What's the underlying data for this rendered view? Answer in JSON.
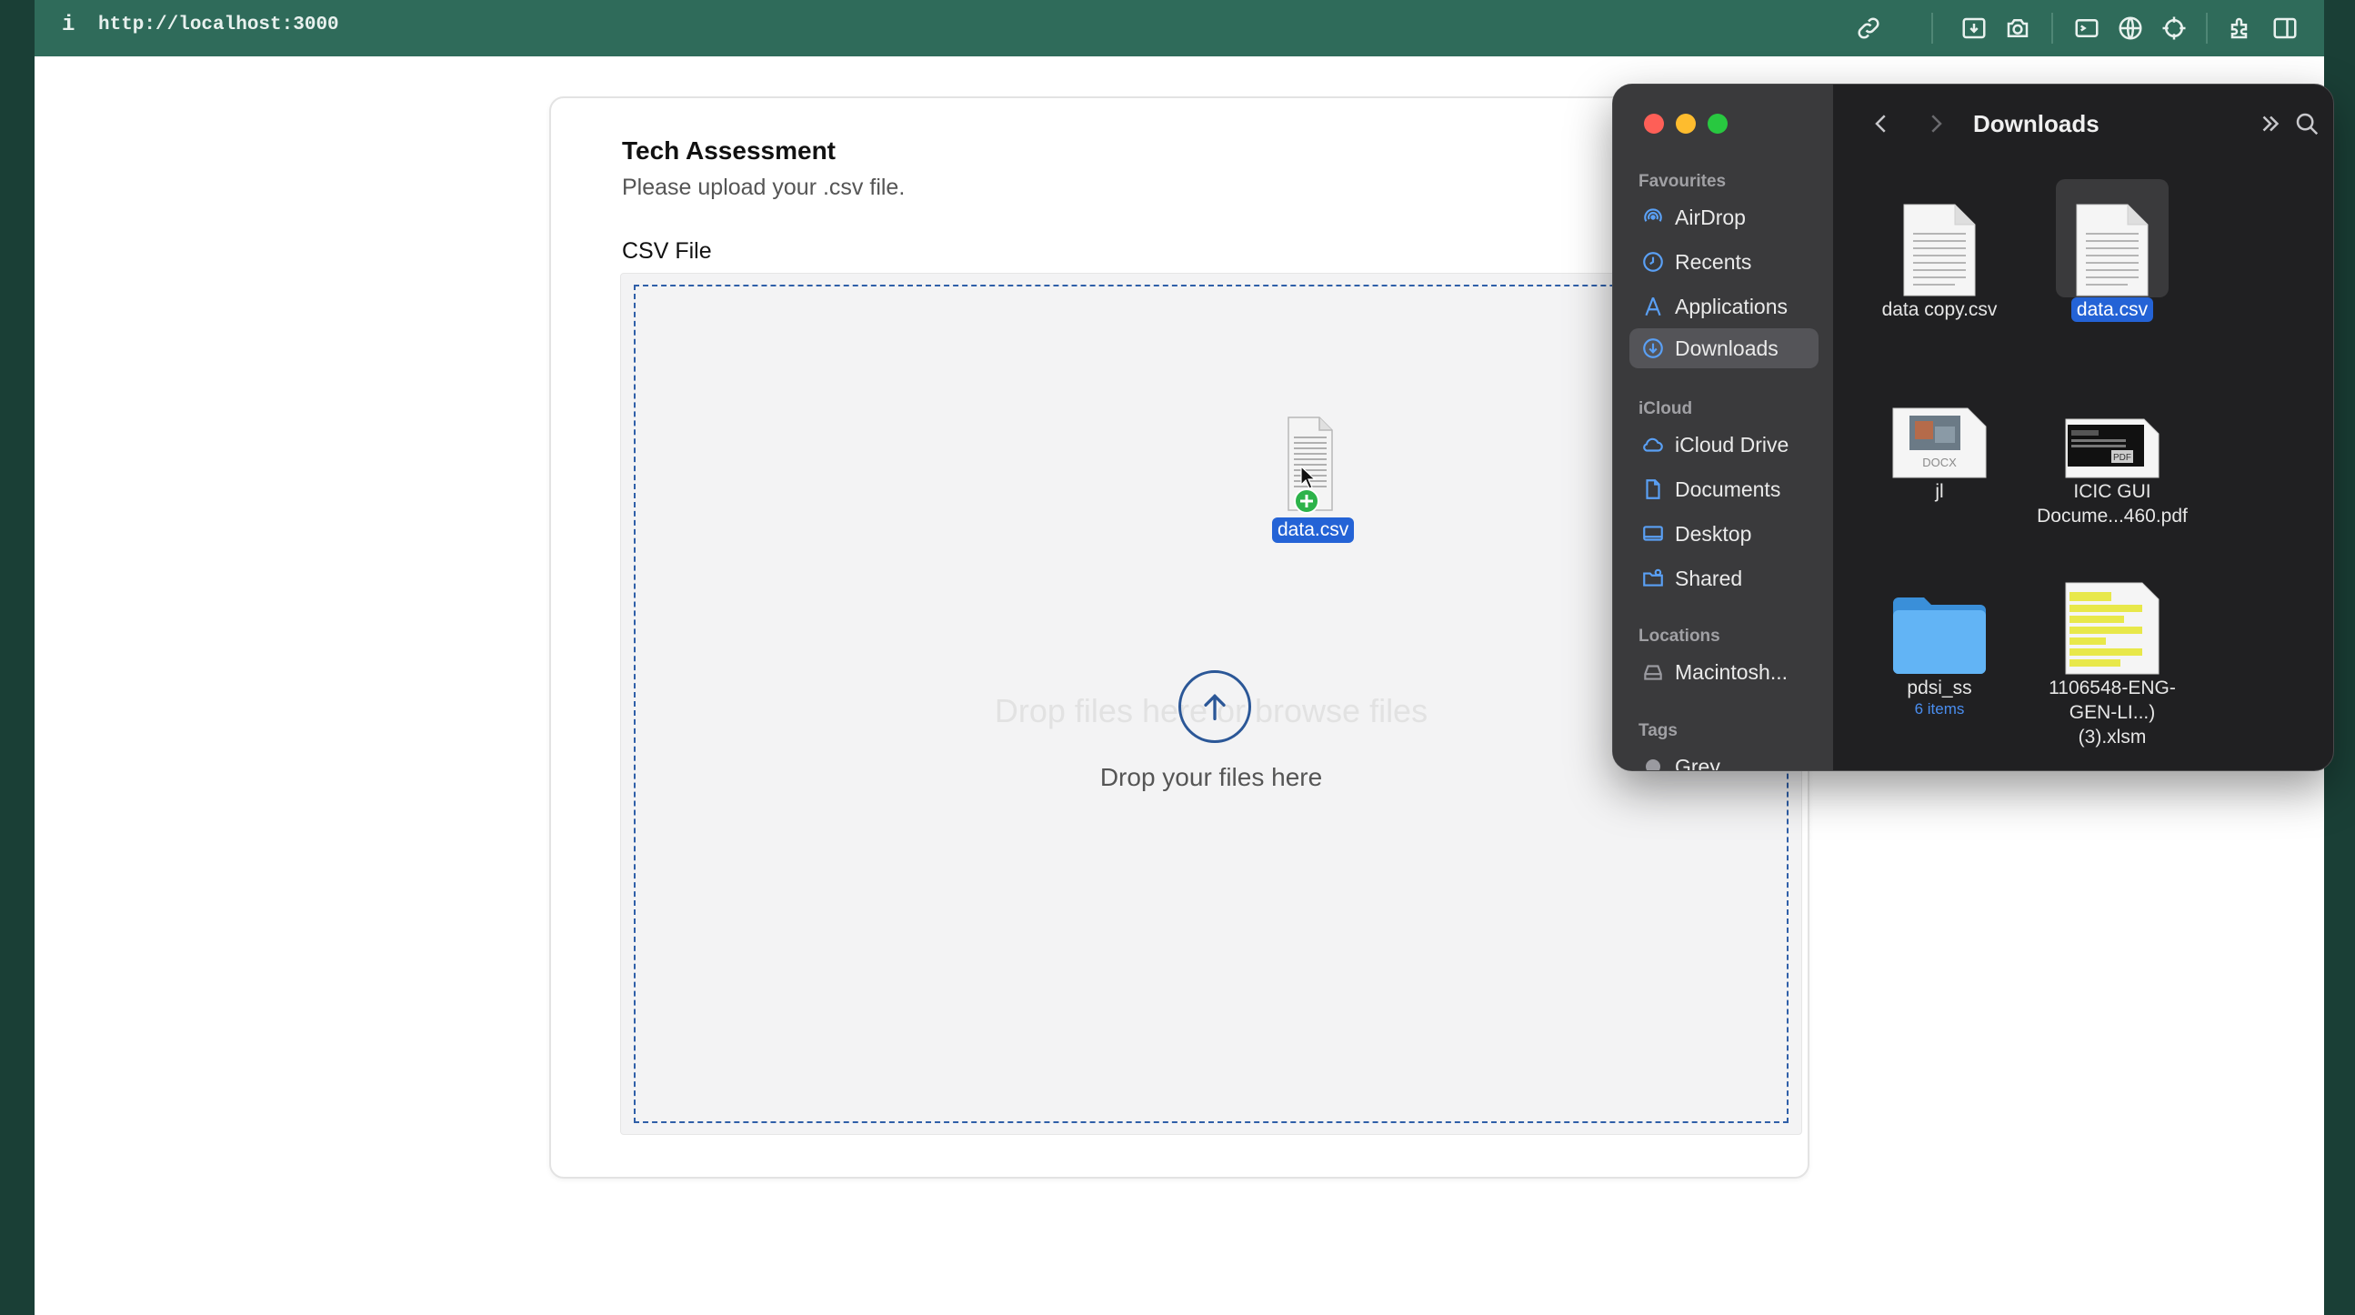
{
  "browser": {
    "info_label": "i",
    "url": "http://localhost:3000"
  },
  "card": {
    "title": "Tech Assessment",
    "subtitle": "Please upload your .csv file.",
    "field_label": "CSV File",
    "ghost_text": "Drop files here or browse files",
    "drop_text": "Drop your files here",
    "dragged_file_name": "data.csv"
  },
  "finder": {
    "title": "Downloads",
    "sidebar": {
      "favourites_label": "Favourites",
      "favourites": [
        "AirDrop",
        "Recents",
        "Applications",
        "Downloads"
      ],
      "icloud_label": "iCloud",
      "icloud": [
        "iCloud Drive",
        "Documents",
        "Desktop",
        "Shared"
      ],
      "locations_label": "Locations",
      "locations": [
        "Macintosh..."
      ],
      "tags_label": "Tags",
      "tags": [
        "Grey"
      ]
    },
    "files": [
      {
        "name": "data copy.csv",
        "sub": "",
        "selected": false
      },
      {
        "name": "data.csv",
        "sub": "",
        "selected": true
      },
      {
        "name": "jl",
        "sub": "",
        "selected": false
      },
      {
        "name_line1": "ICIC GUI",
        "name_line2": "Docume...460.pdf",
        "selected": false
      },
      {
        "name": "pdsi_ss",
        "sub": "6 items",
        "selected": false
      },
      {
        "name_line1": "1106548-ENG-",
        "name_line2": "GEN-LI...) (3).xlsm",
        "selected": false
      }
    ]
  },
  "colors": {
    "topbar": "#2f6b5a",
    "accent": "#2463d6",
    "dropzone_border": "#2f5fa8"
  }
}
